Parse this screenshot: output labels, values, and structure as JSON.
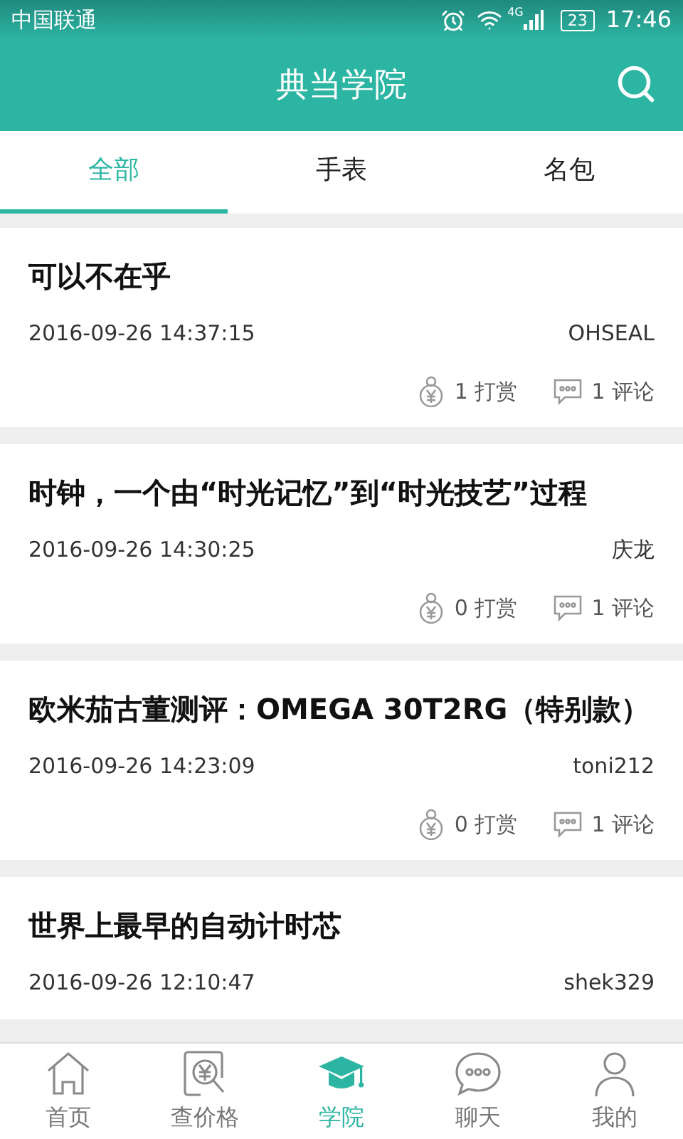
{
  "status_bar": {
    "carrier": "中国联通",
    "network": "4G",
    "battery": "23",
    "time": "17:46"
  },
  "header": {
    "title": "典当学院"
  },
  "tabs": [
    {
      "label": "全部",
      "selected": true
    },
    {
      "label": "手表",
      "selected": false
    },
    {
      "label": "名包",
      "selected": false
    }
  ],
  "articles": [
    {
      "title": "可以不在乎",
      "date": "2016-09-26 14:37:15",
      "author": "OHSEAL",
      "rewards": "1 打赏",
      "comments": "1 评论"
    },
    {
      "title": "时钟，一个由“时光记忆”到“时光技艺”过程",
      "date": "2016-09-26 14:30:25",
      "author": "庆龙",
      "rewards": "0 打赏",
      "comments": "1 评论"
    },
    {
      "title": "欧米茄古董测评：OMEGA 30T2RG（特别款）",
      "date": "2016-09-26 14:23:09",
      "author": "toni212",
      "rewards": "0 打赏",
      "comments": "1 评论"
    },
    {
      "title": "世界上最早的自动计时芯",
      "date": "2016-09-26 12:10:47",
      "author": "shek329"
    }
  ],
  "bottom_nav": [
    {
      "label": "首页",
      "kind": "home",
      "selected": false
    },
    {
      "label": "查价格",
      "kind": "price",
      "selected": false
    },
    {
      "label": "学院",
      "kind": "academy",
      "selected": true
    },
    {
      "label": "聊天",
      "kind": "chat",
      "selected": false
    },
    {
      "label": "我的",
      "kind": "me",
      "selected": false
    }
  ]
}
